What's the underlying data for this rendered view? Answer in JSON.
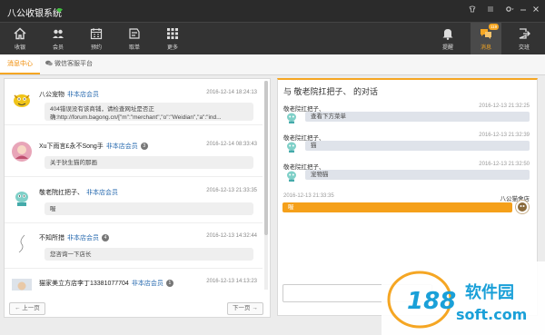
{
  "app": {
    "title": "八公收银系统"
  },
  "toolbar": {
    "items": [
      {
        "label": "收银",
        "icon": "home-icon"
      },
      {
        "label": "会员",
        "icon": "members-icon"
      },
      {
        "label": "预约",
        "icon": "calendar-icon"
      },
      {
        "label": "取单",
        "icon": "pickup-order-icon"
      },
      {
        "label": "更多",
        "icon": "grid-icon"
      }
    ],
    "right_items": [
      {
        "label": "提醒",
        "icon": "bell-icon"
      },
      {
        "label": "消息",
        "icon": "chat-icon",
        "badge": "119",
        "active": true
      },
      {
        "label": "交班",
        "icon": "shift-icon"
      }
    ]
  },
  "tabs": [
    {
      "label": "消息中心",
      "active": true
    },
    {
      "label": "微信客服平台",
      "active": false
    }
  ],
  "conversations": [
    {
      "name": "八公宠物",
      "tag": "非本店会员",
      "time": "2016-12-14 18:24:13",
      "preview_line1": "404错误没有该商铺，请检查网址是否正",
      "preview_line2": "确:http://forum.bagong.cn/[\"m\":\"merchant\",\"o\":\"Weidian\",\"a\":\"ind..."
    },
    {
      "name": "Xu下雨言£永不Song手",
      "tag": "非本店会员",
      "unread": "3",
      "time": "2016-12-14 08:33:43",
      "preview_line1": "关于狄生猫的那画"
    },
    {
      "name": "敬老院扛把子、",
      "tag": "非本店会员",
      "time": "2016-12-13 21:33:35",
      "preview_line1": "喔"
    },
    {
      "name": "不知所措",
      "tag": "非本店会员",
      "unread": "4",
      "time": "2016-12-13 14:32:44",
      "preview_line1": "您咨询一下店长"
    },
    {
      "name": "猫家美立方店李丁13381077704",
      "tag": "非本店会员",
      "unread": "1",
      "time": "2016-12-13 14:13:23",
      "preview_line1": ""
    }
  ],
  "pager": {
    "prev": "← 上一页",
    "next": "下一页 →"
  },
  "chat": {
    "title": "与 敬老院扛把子、 的对话",
    "messages": [
      {
        "name": "敬老院扛把子、",
        "time": "2016-12-13 21:32:25",
        "text": "查看下方菜单"
      },
      {
        "name": "敬老院扛把子、",
        "time": "2016-12-13 21:32:39",
        "text": "猫"
      },
      {
        "name": "敬老院扛把子、",
        "time": "2016-12-13 21:32:50",
        "text": "宠物猫"
      }
    ],
    "self": {
      "name": "八公猫舍店",
      "time": "2016-12-13 21:33:35",
      "text": "喔"
    }
  },
  "watermark": {
    "number": "188",
    "brand": "软件园",
    "domain": "soft.com"
  },
  "colors": {
    "accent": "#f5a623",
    "toolbar": "#333333",
    "titlebar": "#2b2b2b",
    "tag": "#2b6cb0"
  }
}
